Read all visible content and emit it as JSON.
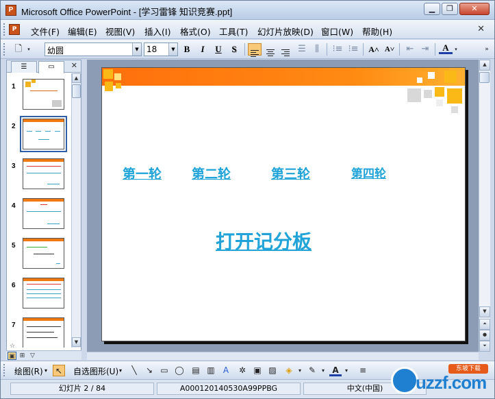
{
  "window": {
    "title": "Microsoft Office PowerPoint - [学习雷锋 知识竞赛.ppt]",
    "app_icon_letter": "P",
    "min_glyph": "▁",
    "max_glyph": "❐",
    "close_glyph": "✕"
  },
  "menubar": {
    "items": [
      "文件(F)",
      "编辑(E)",
      "视图(V)",
      "插入(I)",
      "格式(O)",
      "工具(T)",
      "幻灯片放映(D)",
      "窗口(W)",
      "帮助(H)"
    ],
    "close_glyph": "✕"
  },
  "toolbar": {
    "font_name": "幼圆",
    "font_size": "18",
    "bold": "B",
    "italic": "I",
    "underline": "U",
    "shadow": "S",
    "increase_font": "A˄",
    "decrease_font": "A˅",
    "font_color": "A"
  },
  "outline_pane": {
    "tab_outline_glyph": "☰",
    "tab_slides_glyph": "▭",
    "close_glyph": "✕",
    "slide_numbers": [
      "1",
      "2",
      "3",
      "4",
      "5",
      "6",
      "7"
    ],
    "selected_slide": 2,
    "star": "☆"
  },
  "slide": {
    "rounds": [
      "第一轮",
      "第二轮",
      "第三轮",
      "第四轮"
    ],
    "main_link": "打开记分板",
    "link_color": "#1fa3d8",
    "header_color": "#ff6f0c",
    "accent_color": "#fbb917"
  },
  "drawing_toolbar": {
    "draw_label": "绘图(R)",
    "autoshapes_label": "自选图形(U)"
  },
  "statusbar": {
    "slide_info": "幻灯片 2 / 84",
    "template": "A000120140530A99PPBG",
    "language": "中文(中国)"
  },
  "watermark": {
    "text": "uzzf.com",
    "badge": "东坡下载"
  }
}
